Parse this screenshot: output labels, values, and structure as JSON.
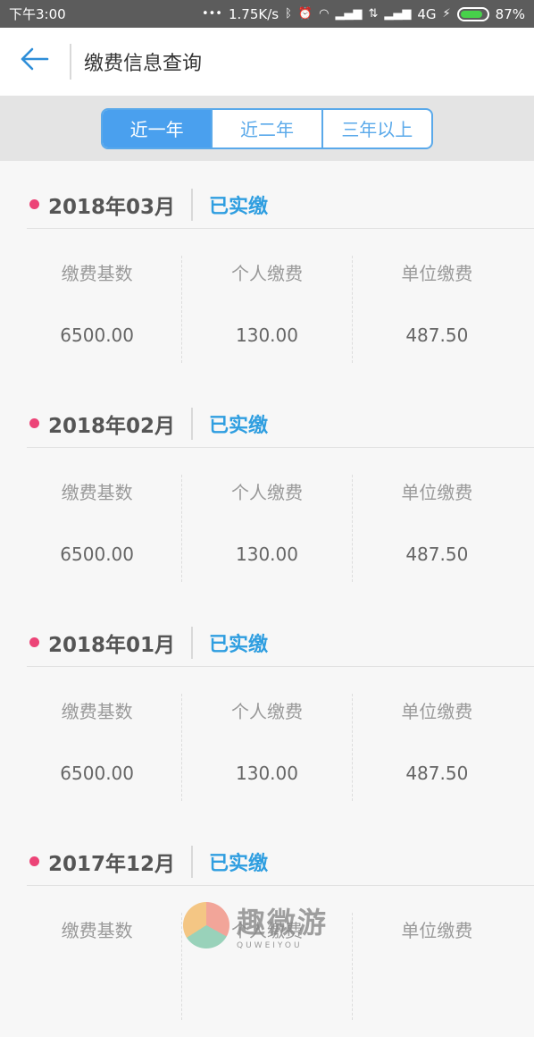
{
  "statusbar": {
    "time": "下午3:00",
    "network_speed": "1.75K/s",
    "network_type": "4G",
    "battery": "87%",
    "battery_level": 0.87,
    "icons": [
      "dots-icon",
      "bluetooth-icon",
      "alarm-icon",
      "wifi-icon",
      "signal-icon",
      "data-arrows-icon",
      "signal-icon",
      "charging-icon",
      "battery-icon"
    ]
  },
  "header": {
    "back_icon": "arrow-left-icon",
    "title": "缴费信息查询"
  },
  "colors": {
    "accent": "#4aa0ee",
    "status_text": "#2f9ee0",
    "dot": "#ec4477"
  },
  "filter": {
    "tabs": [
      {
        "label": "近一年",
        "active": true
      },
      {
        "label": "近二年",
        "active": false
      },
      {
        "label": "三年以上",
        "active": false
      }
    ]
  },
  "columns": [
    "缴费基数",
    "个人缴费",
    "单位缴费"
  ],
  "records": [
    {
      "month": "2018年03月",
      "status": "已实缴",
      "base": "6500.00",
      "personal": "130.00",
      "employer": "487.50"
    },
    {
      "month": "2018年02月",
      "status": "已实缴",
      "base": "6500.00",
      "personal": "130.00",
      "employer": "487.50"
    },
    {
      "month": "2018年01月",
      "status": "已实缴",
      "base": "6500.00",
      "personal": "130.00",
      "employer": "487.50"
    },
    {
      "month": "2017年12月",
      "status": "已实缴"
    }
  ],
  "watermark": {
    "text_cn": "趣微游",
    "text_en": "QUWEIYOU"
  }
}
